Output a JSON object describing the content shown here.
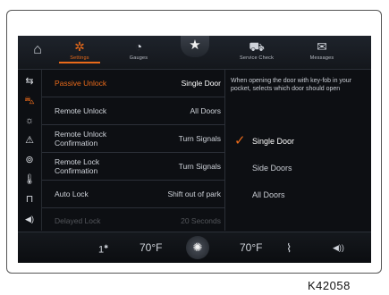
{
  "top_tabs": [
    {
      "label": "Settings",
      "icon": "gear-icon",
      "glyph": "✲"
    },
    {
      "label": "Gauges",
      "icon": "gauge-icon",
      "glyph": "◔"
    },
    {
      "label": "Service Check",
      "icon": "service-check-icon",
      "glyph": "⛟"
    },
    {
      "label": "Messages",
      "icon": "messages-icon",
      "glyph": "✉"
    }
  ],
  "star_glyph": "★",
  "home_glyph": "⌂",
  "sidebar": [
    {
      "icon": "settings-list-icon",
      "glyph": "⇆"
    },
    {
      "icon": "vehicle-icon",
      "glyph": "⛍"
    },
    {
      "icon": "lights-icon",
      "glyph": "☼"
    },
    {
      "icon": "warning-icon",
      "glyph": "⚠"
    },
    {
      "icon": "steering-wheel-icon",
      "glyph": "⊚"
    },
    {
      "icon": "temperature-icon",
      "glyph": "🌡"
    },
    {
      "icon": "seat-icon",
      "glyph": "⊓"
    },
    {
      "icon": "audio-icon",
      "glyph": "◀)"
    }
  ],
  "settings_list": [
    {
      "label": "Passive Unlock",
      "value": "Single Door"
    },
    {
      "label": "Remote Unlock",
      "value": "All Doors"
    },
    {
      "label": "Remote Unlock\nConfirmation",
      "value": "Turn Signals"
    },
    {
      "label": "Remote Lock\nConfirmation",
      "value": "Turn Signals"
    },
    {
      "label": "Auto Lock",
      "value": "Shift out of park"
    },
    {
      "label": "Delayed Lock",
      "value": "20 Seconds"
    }
  ],
  "description": "When opening the door with key-fob in your pocket, selects which door should open",
  "options": [
    "Single Door",
    "Side Doors",
    "All Doors"
  ],
  "selected_option": "Single Door",
  "climate": {
    "left_mode": "1",
    "left_temp": "70°F",
    "right_temp": "70°F"
  },
  "figure_code": "K42058",
  "colors": {
    "accent": "#e96a1a",
    "background": "#0d0f13"
  }
}
